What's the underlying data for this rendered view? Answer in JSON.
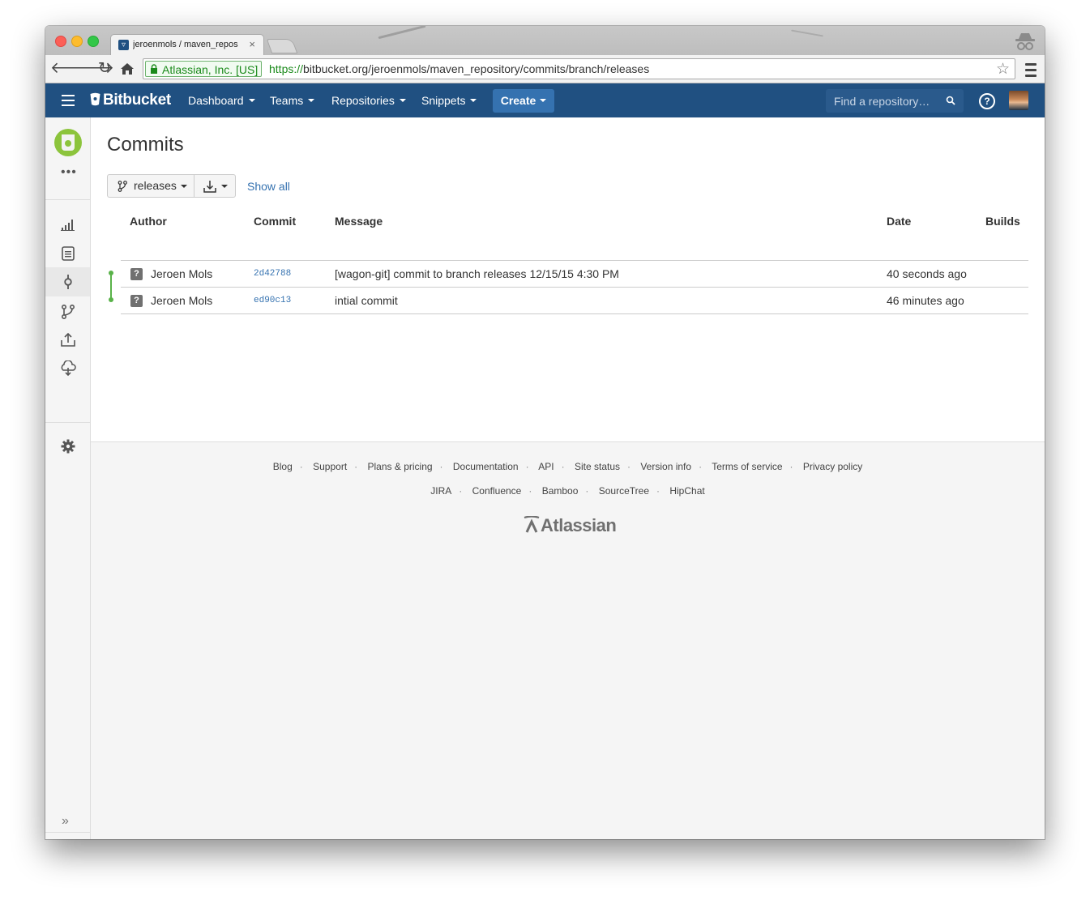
{
  "browser": {
    "tab_title": "jeroenmols / maven_repos",
    "ev_badge": "Atlassian, Inc. [US]",
    "url_scheme": "https://",
    "url_rest": "bitbucket.org/jeroenmols/maven_repository/commits/branch/releases"
  },
  "header": {
    "logo": "Bitbucket",
    "nav": {
      "dashboard": "Dashboard",
      "teams": "Teams",
      "repositories": "Repositories",
      "snippets": "Snippets",
      "create": "Create"
    },
    "search_placeholder": "Find a repository…",
    "help": "?"
  },
  "main": {
    "title": "Commits",
    "branch": "releases",
    "show_all": "Show all",
    "columns": {
      "author": "Author",
      "commit": "Commit",
      "message": "Message",
      "date": "Date",
      "builds": "Builds"
    },
    "commits": [
      {
        "author": "Jeroen Mols",
        "hash": "2d42788",
        "message": "[wagon-git] commit to branch releases 12/15/15 4:30 PM",
        "date": "40 seconds ago"
      },
      {
        "author": "Jeroen Mols",
        "hash": "ed90c13",
        "message": "intial commit",
        "date": "46 minutes ago"
      }
    ]
  },
  "footer": {
    "links_row1": [
      "Blog",
      "Support",
      "Plans & pricing",
      "Documentation",
      "API",
      "Site status",
      "Version info",
      "Terms of service",
      "Privacy policy"
    ],
    "links_row2": [
      "JIRA",
      "Confluence",
      "Bamboo",
      "SourceTree",
      "HipChat"
    ],
    "brand": "Atlassian"
  },
  "colors": {
    "header_bg": "#205081",
    "create_bg": "#3572b0",
    "link": "#3572b0",
    "graph": "#59b249"
  }
}
